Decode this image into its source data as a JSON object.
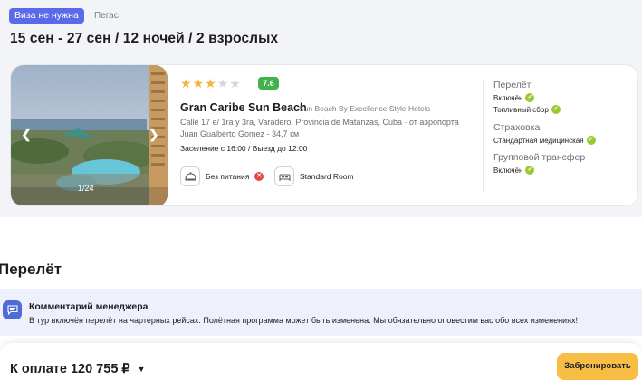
{
  "header": {
    "visa_badge": "Виза не нужна",
    "operator": "Пегас",
    "dates": "15 сен - 27 сен / 12 ночей / 2 взрослых"
  },
  "hotel": {
    "photo_counter": "1/24",
    "stars_total": 5,
    "stars_filled": 3,
    "rating": "7.6",
    "name": "Gran Caribe Sun Beach",
    "chain": "Sun Beach By Excellence Style Hotels",
    "address": "Calle 17 e/ 1ra y 3ra, Varadero, Provincia de Matanzas, Cuba · от аэропорта Juan Gualberto Gomez - 34,7 км",
    "checkin": "Заселение с 16:00 / Выезд до 12:00",
    "meal": "Без питания",
    "room": "Standard Room"
  },
  "includes": {
    "flight_title": "Перелёт",
    "flight_items": [
      "Включён",
      "Топливный сбор"
    ],
    "insurance_title": "Страховка",
    "insurance_items": [
      "Стандартная медицинская"
    ],
    "transfer_title": "Групповой трансфер",
    "transfer_items": [
      "Включён"
    ]
  },
  "flight_section": {
    "title": "Перелёт",
    "comment_title": "Комментарий менеджера",
    "comment_text": "В тур включён перелёт на чартерных рейсах. Полётная программа может быть изменена. Мы обязательно оповестим вас обо всех изменениях!"
  },
  "footer": {
    "price": "К оплате 120 755 ₽",
    "book_button": "Забронировать"
  },
  "colors": {
    "visa_badge": "#5b6ae8",
    "rating_badge": "#3fb24a",
    "check": "#9bc92f",
    "book_button": "#f7bd45",
    "comment_bg": "#eef1fb"
  },
  "icons": {
    "arrow_left": "chevron-left-icon",
    "arrow_right": "chevron-right-icon",
    "meal": "cloche-icon",
    "no_meal": "x-icon",
    "room": "bed-icon",
    "check": "check-icon",
    "comment": "chat-icon",
    "price_toggle": "chevron-down-icon"
  }
}
